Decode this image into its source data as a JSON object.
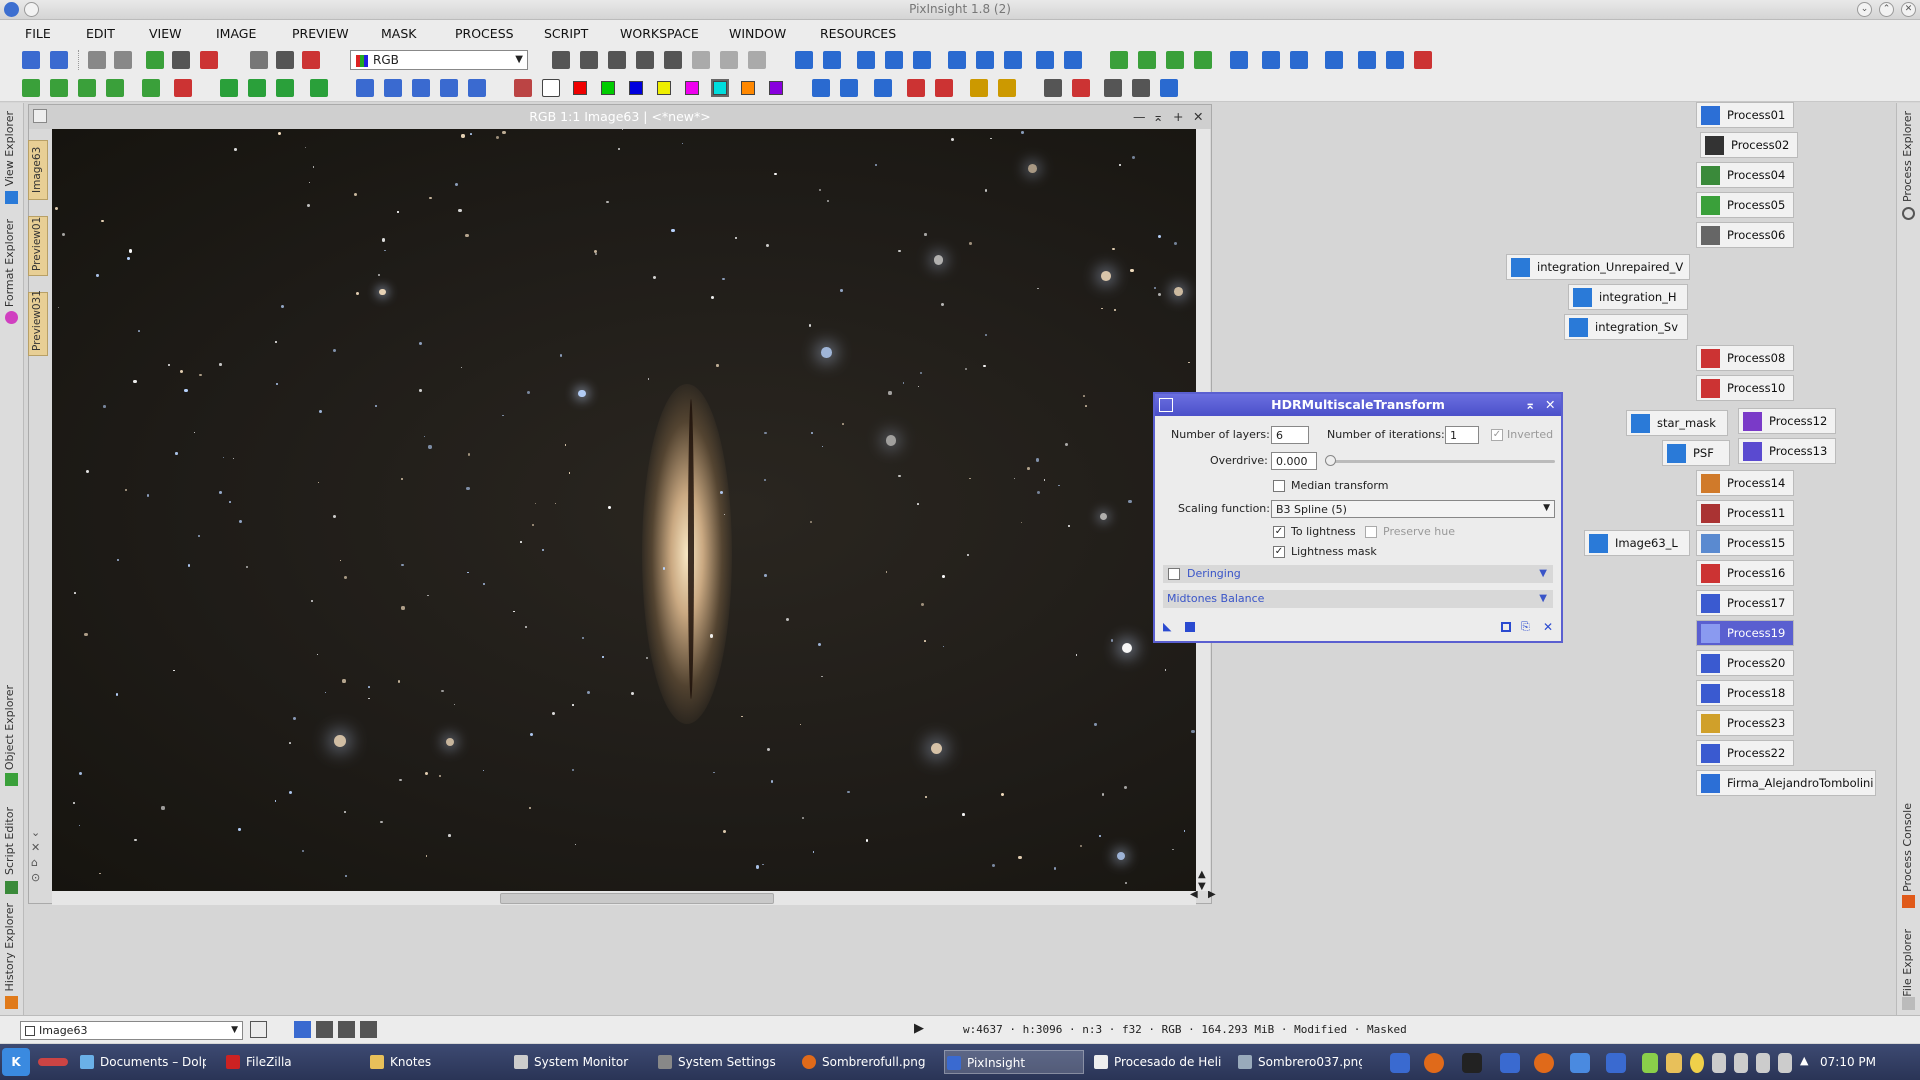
{
  "window": {
    "title": "PixInsight 1.8 (2)"
  },
  "menu": [
    "FILE",
    "EDIT",
    "VIEW",
    "IMAGE",
    "PREVIEW",
    "MASK",
    "PROCESS",
    "SCRIPT",
    "WORKSPACE",
    "WINDOW",
    "RESOURCES"
  ],
  "toolbar": {
    "channel_select": "RGB"
  },
  "left_tabs": {
    "view_explorer": "View Explorer",
    "format_explorer": "Format Explorer",
    "object_explorer": "Object Explorer",
    "script_editor": "Script Editor",
    "history_explorer": "History Explorer"
  },
  "image_tabs": [
    "Image63",
    "Preview01",
    "Preview031"
  ],
  "image_window": {
    "title": "RGB 1:1 Image63 | <*new*>"
  },
  "hdr": {
    "title": "HDRMultiscaleTransform",
    "layers_label": "Number of layers:",
    "layers_value": "6",
    "iter_label": "Number of iterations:",
    "iter_value": "1",
    "inverted_label": "Inverted",
    "overdrive_label": "Overdrive:",
    "overdrive_value": "0.000",
    "median_label": "Median transform",
    "scaling_label": "Scaling function:",
    "scaling_value": "B3 Spline (5)",
    "lightness_label": "To lightness",
    "preserve_label": "Preserve hue",
    "lmask_label": "Lightness mask",
    "deringing": "Deringing",
    "midtones": "Midtones Balance"
  },
  "process_icons": [
    {
      "label": "Process01",
      "color": "#2c6fd6"
    },
    {
      "label": "Process02",
      "color": "#333"
    },
    {
      "label": "Process04",
      "color": "#3a8a3a"
    },
    {
      "label": "Process05",
      "color": "#3aa03a"
    },
    {
      "label": "Process06",
      "color": "#666"
    },
    {
      "label": "integration_Unrepaired_V",
      "color": "#2a7ad8"
    },
    {
      "label": "integration_H",
      "color": "#2a7ad8"
    },
    {
      "label": "integration_Sv",
      "color": "#2a7ad8"
    },
    {
      "label": "Process08",
      "color": "#c33"
    },
    {
      "label": "Process10",
      "color": "#c33"
    },
    {
      "label": "star_mask",
      "color": "#2a7ad8"
    },
    {
      "label": "Process12",
      "color": "#7a3ac8"
    },
    {
      "label": "PSF",
      "color": "#2a7ad8"
    },
    {
      "label": "Process13",
      "color": "#5a4ad0"
    },
    {
      "label": "Process14",
      "color": "#d07a2a"
    },
    {
      "label": "Process11",
      "color": "#a33"
    },
    {
      "label": "Process15",
      "color": "#5a8ad0"
    },
    {
      "label": "Image63_L",
      "color": "#2a7ad8"
    },
    {
      "label": "Process16",
      "color": "#c33"
    },
    {
      "label": "Process17",
      "color": "#3a5ad0"
    },
    {
      "label": "Process19",
      "color": "#3a5ad0"
    },
    {
      "label": "Process20",
      "color": "#3a5ad0"
    },
    {
      "label": "Process18",
      "color": "#3a5ad0"
    },
    {
      "label": "Process23",
      "color": "#d0a02a"
    },
    {
      "label": "Process22",
      "color": "#3a5ad0"
    },
    {
      "label": "Firma_AlejandroTombolini",
      "color": "#2c6fd6"
    }
  ],
  "right_tabs": {
    "process_explorer": "Process Explorer",
    "process_console": "Process Console",
    "file_explorer": "File Explorer"
  },
  "status": {
    "view": "Image63",
    "info": "w:4637 · h:3096 · n:3 · f32 · RGB · 164.293 MiB · Modified · Masked"
  },
  "taskbar": {
    "items": [
      "Documents – Dolph",
      "FileZilla",
      "Knotes",
      "System Monitor",
      "System Settings",
      "Sombrerofull.png",
      "PixInsight",
      "Procesado de Heli",
      "Sombrero037.png"
    ],
    "clock": "07:10 PM"
  }
}
